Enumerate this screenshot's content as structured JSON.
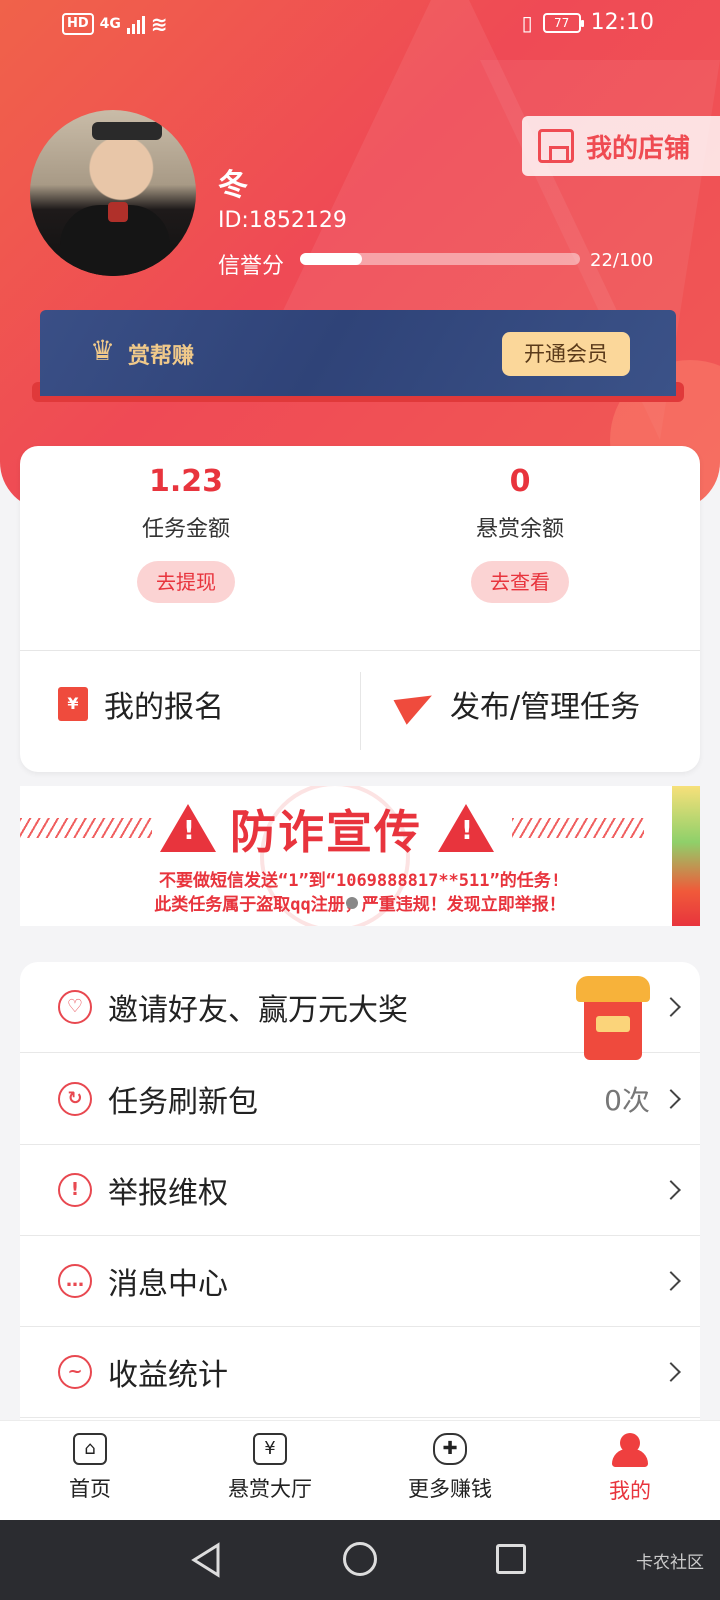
{
  "status": {
    "network": "4G",
    "battery": "77",
    "time": "12:10"
  },
  "profile": {
    "name": "冬",
    "id": "ID:1852129",
    "credit_label": "信誉分",
    "credit_value": "22/100",
    "credit_fraction": 0.22
  },
  "shop_button": "我的店铺",
  "vip": {
    "title": "赏帮赚",
    "button": "开通会员"
  },
  "stats": [
    {
      "value": "1.23",
      "label": "任务金额",
      "action": "去提现"
    },
    {
      "value": "0",
      "label": "悬赏余额",
      "action": "去查看"
    }
  ],
  "actions": {
    "signup": "我的报名",
    "publish": "发布/管理任务"
  },
  "banner": {
    "title": "防诈宣传",
    "line1": "不要做短信发送“1”到“1069888817**511”的任务!",
    "line2": "此类任务属于盗取qq注册，严重违规！发现立即举报！"
  },
  "menu": [
    {
      "label": "邀请好友、赢万元大奖",
      "value": "",
      "icon": "heart-icon"
    },
    {
      "label": "任务刷新包",
      "value": "0次",
      "icon": "refresh-icon"
    },
    {
      "label": "举报维权",
      "value": "",
      "icon": "warning-icon"
    },
    {
      "label": "消息中心",
      "value": "",
      "icon": "message-icon"
    },
    {
      "label": "收益统计",
      "value": "",
      "icon": "chart-icon"
    }
  ],
  "tabs": [
    {
      "label": "首页",
      "icon": "home-icon"
    },
    {
      "label": "悬赏大厅",
      "icon": "yuan-icon"
    },
    {
      "label": "更多赚钱",
      "icon": "gamepad-icon"
    },
    {
      "label": "我的",
      "icon": "user-icon"
    }
  ],
  "watermark": "卡农社区",
  "colors": {
    "accent": "#e8343d",
    "hero": "#ef4a55",
    "vip": "#2f4378",
    "vip_gold": "#f0c98a"
  }
}
